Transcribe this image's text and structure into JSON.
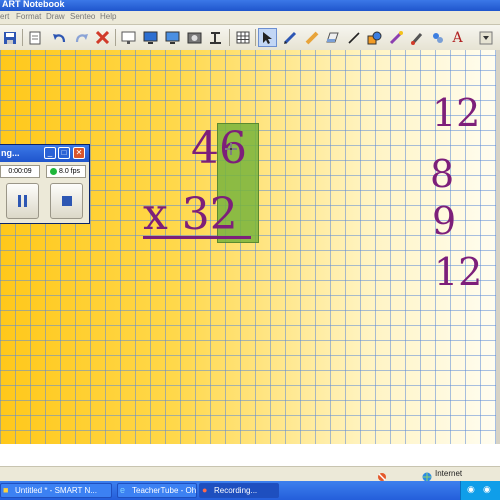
{
  "window": {
    "title": "ART Notebook"
  },
  "menu": [
    "ert",
    "Format",
    "Draw",
    "Senteo",
    "Help"
  ],
  "toolbar": {
    "icons": [
      "save-icon",
      "page-icon",
      "undo-icon",
      "redo-icon",
      "delete-icon",
      "screen-shade-icon",
      "monitor-icon",
      "monitor-2-icon",
      "camera-icon",
      "document-camera-icon",
      "table-icon",
      "select-icon",
      "pen-icon",
      "highlighter-icon",
      "eraser-icon",
      "line-icon",
      "shape-icon",
      "magic-pen-icon",
      "fill-icon",
      "text-icon",
      "more-icon"
    ]
  },
  "canvas": {
    "problem": {
      "top": "46",
      "bottom": "x 32"
    },
    "side_numbers": [
      "12",
      "8",
      "9",
      "12"
    ]
  },
  "recorder": {
    "title": "ng...",
    "time": "0:00:09",
    "fps": "8.0 fps"
  },
  "statusbar": {
    "zone": "Internet"
  },
  "taskbar": {
    "items": [
      "Untitled * - SMART N...",
      "TeacherTube - Ohio ...",
      "Recording..."
    ]
  }
}
